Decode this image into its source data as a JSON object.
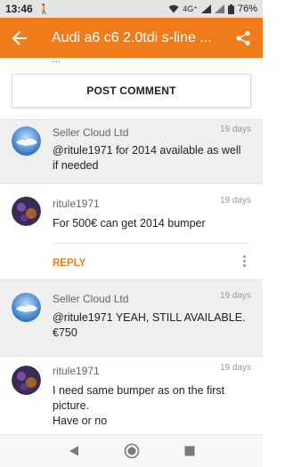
{
  "status_bar": {
    "time": "13:46",
    "walk_icon": "🚶",
    "network": "4G⁺",
    "battery": "76%"
  },
  "app_bar": {
    "title": "Audi a6 c6 2.0tdi s-line ...",
    "background": "#f07b1a"
  },
  "partial_text": "...",
  "post_comment_label": "POST COMMENT",
  "comments": [
    {
      "author": "Seller Cloud Ltd",
      "date": "19 days",
      "body": "@ritule1971 for 2014 available as well if needed"
    },
    {
      "author": "ritule1971",
      "date": "19 days",
      "body": "For 500€ can get 2014 bumper",
      "reply_label": "REPLY"
    },
    {
      "author": "Seller Cloud Ltd",
      "date": "19 days",
      "body": "@ritule1971 YEAH, STILL AVAILABLE. €750"
    },
    {
      "author": "ritule1971",
      "date": "19 days",
      "body_lines": [
        "I need same bumper as on the first picture.",
        "Have or no"
      ]
    }
  ],
  "accent_color": "#f07b1a"
}
